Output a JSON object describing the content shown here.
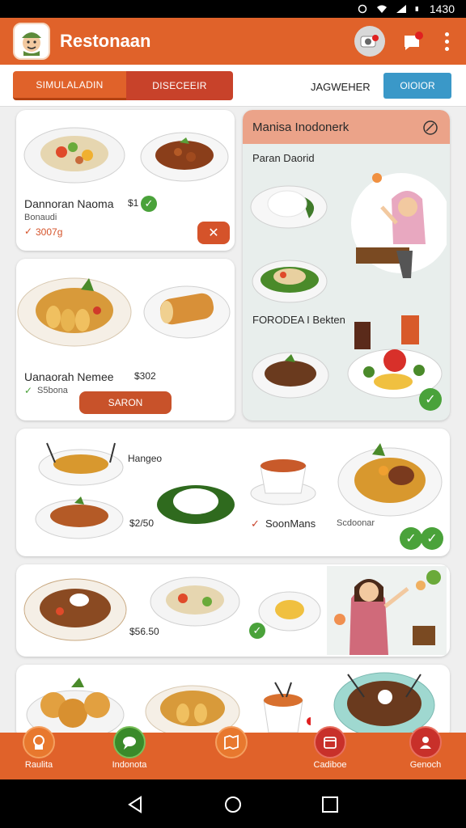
{
  "status_bar": {
    "time": "1430"
  },
  "app_bar": {
    "title": "Restonaan"
  },
  "tabs": {
    "items": [
      {
        "label": "SIMULALADIN"
      },
      {
        "label": "DISECEEIR"
      }
    ],
    "plain_label": "JAGWEHER",
    "order_label": "OIOIOR"
  },
  "cards": {
    "c1": {
      "title": "Dannoran Naoma",
      "price": "$1",
      "subtitle": "Bonaudi",
      "meta": "3007g"
    },
    "c2": {
      "title": "Uanaorah Nemee",
      "price": "$302",
      "subtitle": "S5bona",
      "button": "SARON"
    },
    "c3": {
      "label_top": "Hangeo",
      "price": "$2/50",
      "drink_label": "SoonMans",
      "side_label": "Scdoonar"
    },
    "c4": {
      "price": "$56.50"
    }
  },
  "right_panel": {
    "title": "Manisa Inodonerk",
    "section1": "Paran Daorid",
    "section2": "FORODEA I Bekten"
  },
  "bottom_nav": {
    "items": [
      {
        "label": "Raulita"
      },
      {
        "label": "Indonota"
      },
      {
        "label": ""
      },
      {
        "label": "Cadiboe"
      },
      {
        "label": "Genoch"
      }
    ]
  },
  "colors": {
    "primary": "#e0622a",
    "accent_blue": "#3a98c8",
    "success": "#4aa23a"
  }
}
